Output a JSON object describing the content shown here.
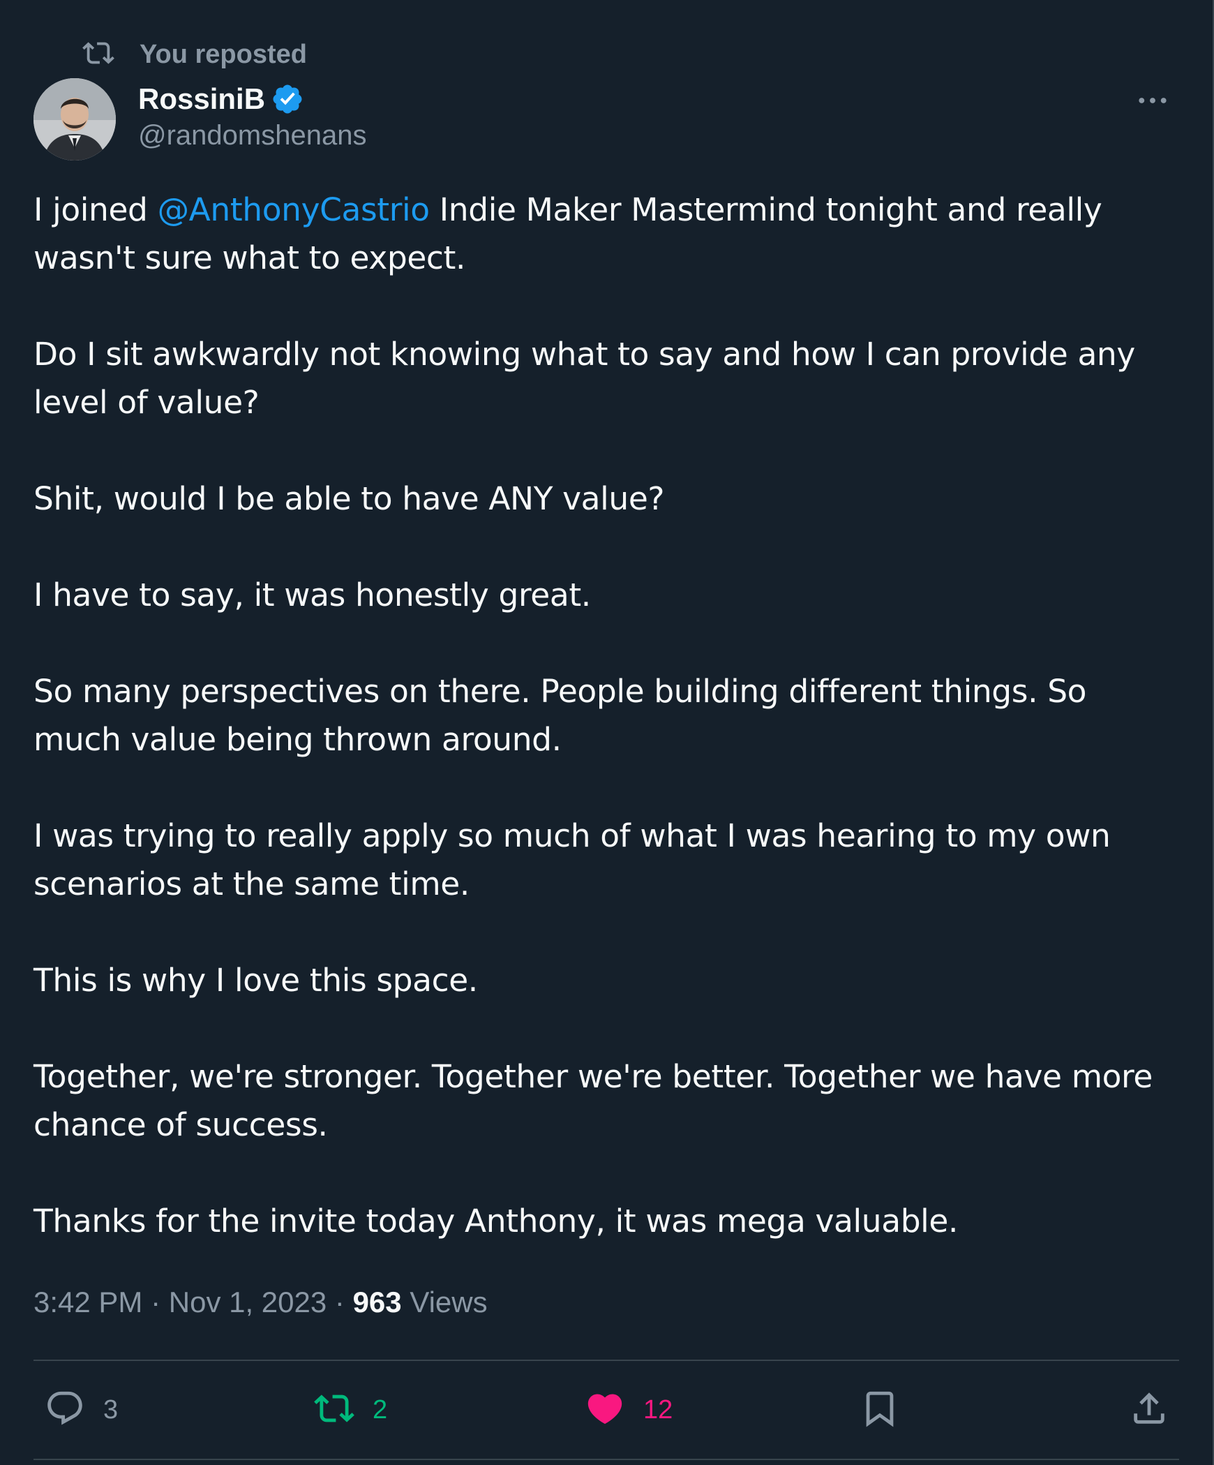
{
  "repost": {
    "label": "You reposted",
    "icon": "repost-icon"
  },
  "author": {
    "name": "RossiniB",
    "handle": "@randomshenans",
    "verified": true,
    "verified_icon": "verified-badge-icon",
    "avatar": "avatar-photo"
  },
  "more_icon": "more-options-icon",
  "tweet": {
    "line1_prefix": "I joined ",
    "mention": "@AnthonyCastrio",
    "line1_suffix": " Indie Maker Mastermind tonight and really wasn't sure what to expect.",
    "paragraphs": [
      "Do I sit awkwardly not knowing what to say and how I can provide any level of value?",
      "Shit, would I be able to have ANY value?",
      "I have to say, it was honestly great.",
      "So many perspectives on there. People building different things. So much value being thrown around.",
      "I was trying to really apply so much of what I was hearing to my own scenarios at the same time.",
      "This is why I love this space.",
      "Together, we're stronger. Together we're better. Together we have more chance of success.",
      "Thanks for the invite today Anthony, it was mega valuable."
    ]
  },
  "meta": {
    "time": "3:42 PM",
    "separator": " · ",
    "date": "Nov 1, 2023",
    "views_count": "963",
    "views_label": " Views"
  },
  "actions": {
    "reply": {
      "icon": "reply-icon",
      "count": "3"
    },
    "repost": {
      "icon": "repost-icon",
      "count": "2",
      "color": "#00ba7c"
    },
    "like": {
      "icon": "heart-icon",
      "count": "12",
      "color": "#f91880"
    },
    "bookmark": {
      "icon": "bookmark-icon"
    },
    "share": {
      "icon": "share-icon"
    }
  },
  "colors": {
    "background": "#15202b",
    "text": "#f7f9f9",
    "secondary_text": "#8b98a5",
    "accent": "#1d9bf0"
  }
}
